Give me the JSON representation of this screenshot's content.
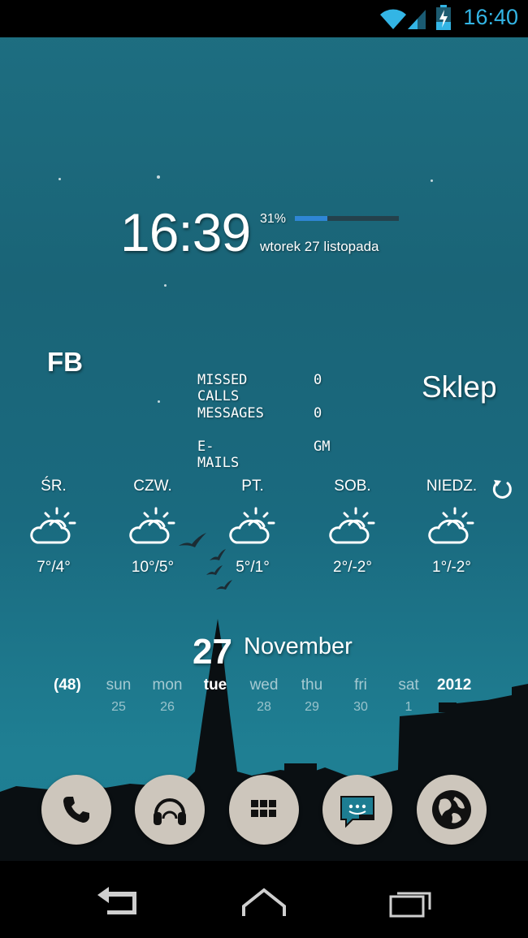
{
  "status_bar": {
    "time": "16:40",
    "icons": [
      "wifi-icon",
      "signal-icon",
      "battery-charging-icon"
    ],
    "accent_color": "#33b5e5"
  },
  "clock_widget": {
    "time": "16:39",
    "battery_percent_text": "31%",
    "battery_level": 0.31,
    "date": "wtorek 27 listopada",
    "bar_color": "#2f86d6"
  },
  "shortcuts": {
    "left_label": "FB",
    "right_label": "Sklep"
  },
  "counters": [
    {
      "label": "MISSED CALLS",
      "value": "0"
    },
    {
      "label": "MESSAGES",
      "value": "0"
    },
    {
      "label": "E-MAILS",
      "value": "GM"
    }
  ],
  "weather": {
    "days": [
      {
        "name": "ŚR.",
        "temp": "7°/4°",
        "icon": "partly-cloudy-icon"
      },
      {
        "name": "CZW.",
        "temp": "10°/5°",
        "icon": "partly-cloudy-icon"
      },
      {
        "name": "PT.",
        "temp": "5°/1°",
        "icon": "partly-cloudy-icon"
      },
      {
        "name": "SOB.",
        "temp": "2°/-2°",
        "icon": "partly-cloudy-icon"
      },
      {
        "name": "NIEDZ.",
        "temp": "1°/-2°",
        "icon": "partly-cloudy-icon"
      }
    ],
    "refresh_icon": "refresh-icon"
  },
  "calendar": {
    "day": "27",
    "month": "November",
    "week": "(48)",
    "year": "2012",
    "days": [
      {
        "wd": "sun",
        "dn": "25"
      },
      {
        "wd": "mon",
        "dn": "26"
      },
      {
        "wd": "tue",
        "dn": ""
      },
      {
        "wd": "wed",
        "dn": "28"
      },
      {
        "wd": "thu",
        "dn": "29"
      },
      {
        "wd": "fri",
        "dn": "30"
      },
      {
        "wd": "sat",
        "dn": "1"
      }
    ],
    "today_index": 2
  },
  "dock": [
    {
      "name": "phone-icon"
    },
    {
      "name": "headphones-icon"
    },
    {
      "name": "app-drawer-icon"
    },
    {
      "name": "messaging-icon"
    },
    {
      "name": "browser-globe-icon"
    }
  ],
  "navigation": [
    "back-icon",
    "home-icon",
    "recent-apps-icon"
  ]
}
